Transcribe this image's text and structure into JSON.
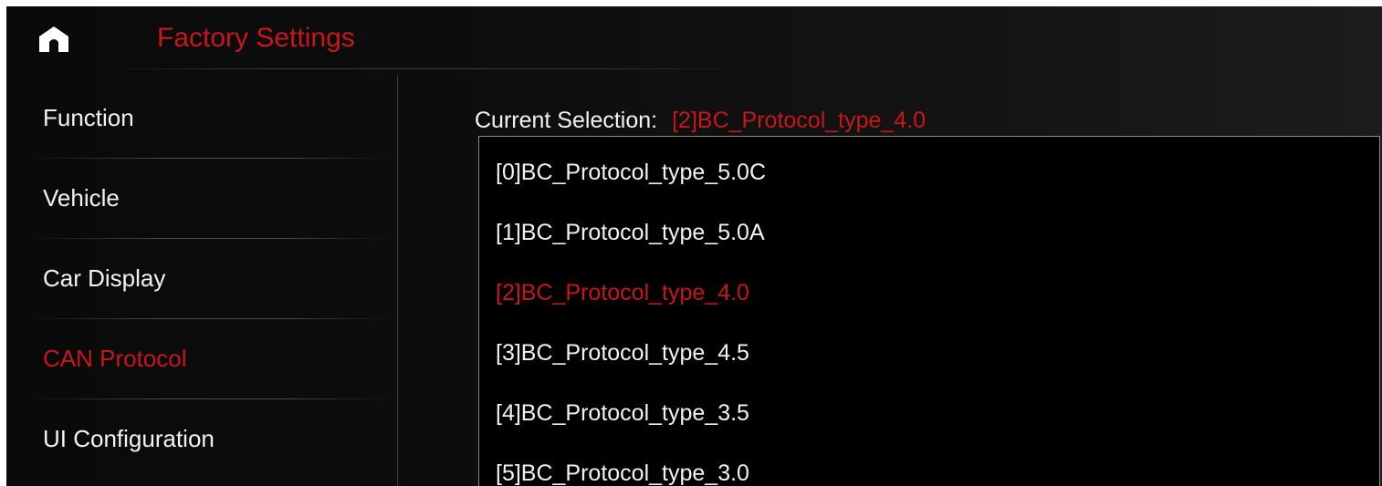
{
  "header": {
    "title": "Factory Settings",
    "home_icon": "home-icon",
    "accent_color": "#c8161b"
  },
  "sidebar": {
    "items": [
      {
        "label": "Function",
        "active": false
      },
      {
        "label": "Vehicle",
        "active": false
      },
      {
        "label": "Car Display",
        "active": false
      },
      {
        "label": "CAN Protocol",
        "active": true
      },
      {
        "label": "UI Configuration",
        "active": false
      }
    ]
  },
  "main": {
    "current_label": "Current Selection:",
    "current_value": "[2]BC_Protocol_type_4.0",
    "options": [
      {
        "label": "[0]BC_Protocol_type_5.0C",
        "selected": false
      },
      {
        "label": "[1]BC_Protocol_type_5.0A",
        "selected": false
      },
      {
        "label": "[2]BC_Protocol_type_4.0",
        "selected": true
      },
      {
        "label": "[3]BC_Protocol_type_4.5",
        "selected": false
      },
      {
        "label": "[4]BC_Protocol_type_3.5",
        "selected": false
      },
      {
        "label": "[5]BC_Protocol_type_3.0",
        "selected": false
      }
    ]
  }
}
